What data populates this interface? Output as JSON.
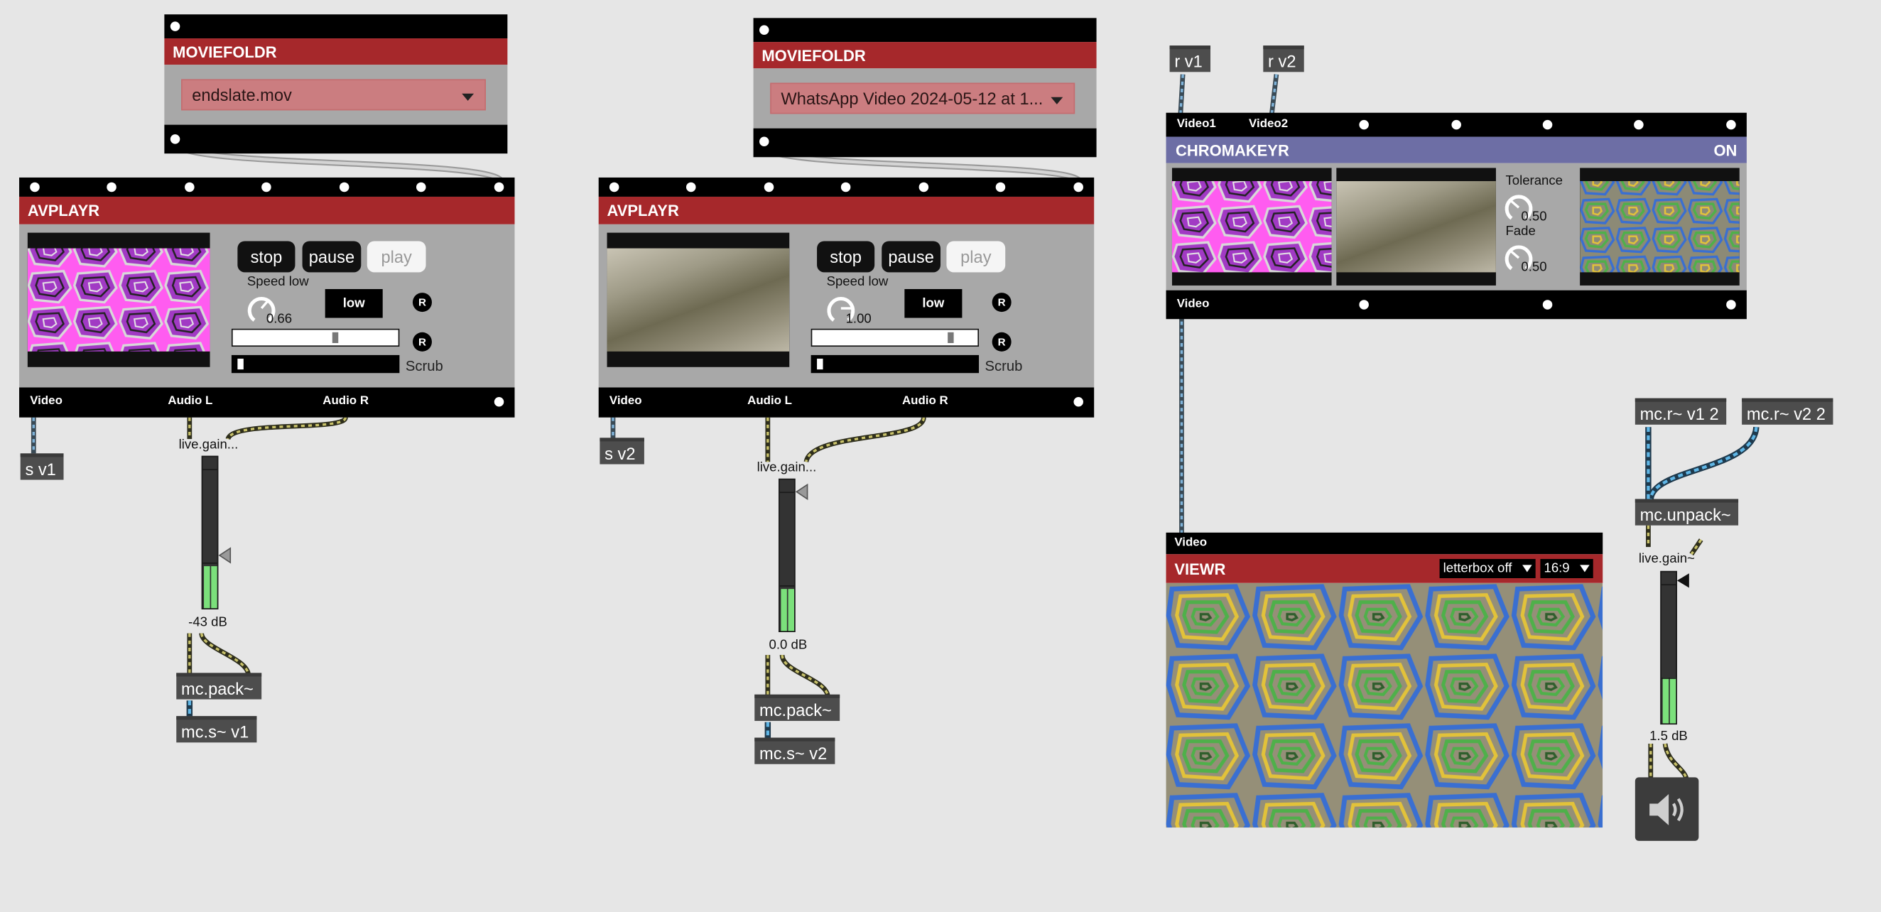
{
  "moviefoldr1": {
    "title": "MOVIEFOLDR",
    "selected": "endslate.mov"
  },
  "moviefoldr2": {
    "title": "MOVIEFOLDR",
    "selected": "WhatsApp Video 2024-05-12 at 1..."
  },
  "avplayr1": {
    "title": "AVPLAYR",
    "stop": "stop",
    "pause": "pause",
    "play": "play",
    "speed_label": "Speed low",
    "speed_value": "0.66",
    "mode": "low",
    "r1": "R",
    "r2": "R",
    "scrub": "Scrub",
    "out_video": "Video",
    "out_audio_l": "Audio L",
    "out_audio_r": "Audio R",
    "slider_position": 0.62,
    "scrub_position": 0.02
  },
  "avplayr2": {
    "title": "AVPLAYR",
    "stop": "stop",
    "pause": "pause",
    "play": "play",
    "speed_label": "Speed low",
    "speed_value": "1.00",
    "mode": "low",
    "r1": "R",
    "r2": "R",
    "scrub": "Scrub",
    "out_video": "Video",
    "out_audio_l": "Audio L",
    "out_audio_r": "Audio R",
    "slider_position": 0.85,
    "scrub_position": 0.02
  },
  "chain1": {
    "send": "s v1",
    "gain_label": "live.gain...",
    "gain_value": "-43 dB",
    "pack": "mc.pack~",
    "mcsend": "mc.s~ v1",
    "meter_level": 0.28
  },
  "chain2": {
    "send": "s v2",
    "gain_label": "live.gain...",
    "gain_value": "0.0 dB",
    "pack": "mc.pack~",
    "mcsend": "mc.s~ v2",
    "meter_level": 0.28
  },
  "receivers": {
    "r1": "r v1",
    "r2": "r v2"
  },
  "chromakeyr": {
    "title": "CHROMAKEYR",
    "status": "ON",
    "in_video1": "Video1",
    "in_video2": "Video2",
    "tolerance_label": "Tolerance",
    "tolerance_value": "0.50",
    "fade_label": "Fade",
    "fade_value": "0.50",
    "out_video": "Video"
  },
  "viewr": {
    "in_video": "Video",
    "title": "VIEWR",
    "letterbox": "letterbox off",
    "aspect": "16:9"
  },
  "chain3": {
    "recv1": "mc.r~ v1 2",
    "recv2": "mc.r~ v2 2",
    "unpack": "mc.unpack~",
    "gain_label": "live.gain~",
    "gain_value": "1.5 dB",
    "meter_level": 0.3
  },
  "colors": {
    "header_red": "#a6282b",
    "header_purple": "#6d6ea5",
    "meter_green": "#7be07b",
    "cable_yellow": "#c9c26a",
    "cable_blue": "#5fb6e6"
  },
  "icons": {
    "speaker": "speaker-icon"
  }
}
